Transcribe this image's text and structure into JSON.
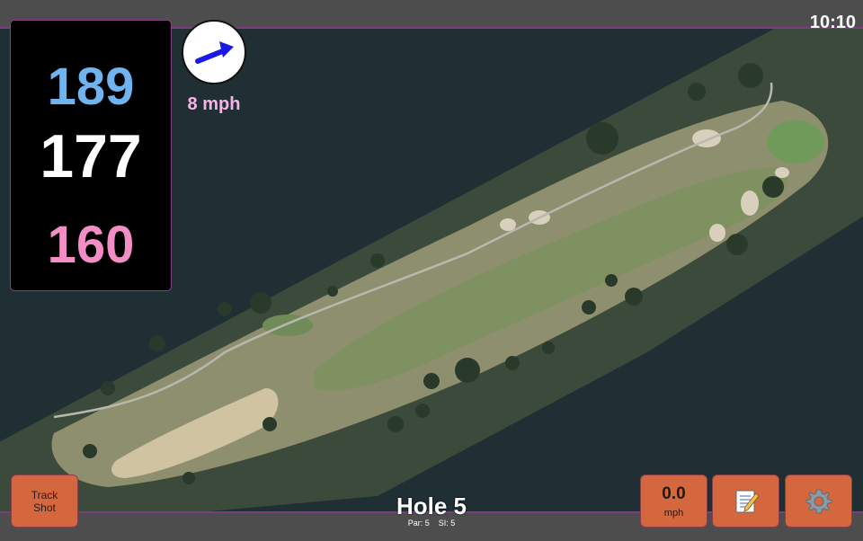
{
  "status": {
    "time": "10:10"
  },
  "yardages": {
    "back": "189",
    "middle": "177",
    "front": "160"
  },
  "wind": {
    "speed": "8 mph",
    "icon": "wind-direction-arrow-icon",
    "direction": "northeast"
  },
  "hole": {
    "title": "Hole 5",
    "par": "Par: 5",
    "si": "SI: 5"
  },
  "buttons": {
    "track_shot_line1": "Track",
    "track_shot_line2": "Shot",
    "speed_value": "0.0",
    "speed_unit": "mph",
    "notes_icon": "notepad-icon",
    "settings_icon": "gear-icon"
  },
  "colors": {
    "back_yardage": "#6fb4ef",
    "middle_yardage": "#ffffff",
    "front_yardage": "#f48dc6",
    "button_bg": "#d4673e",
    "accent_border": "#7a3f7a"
  }
}
